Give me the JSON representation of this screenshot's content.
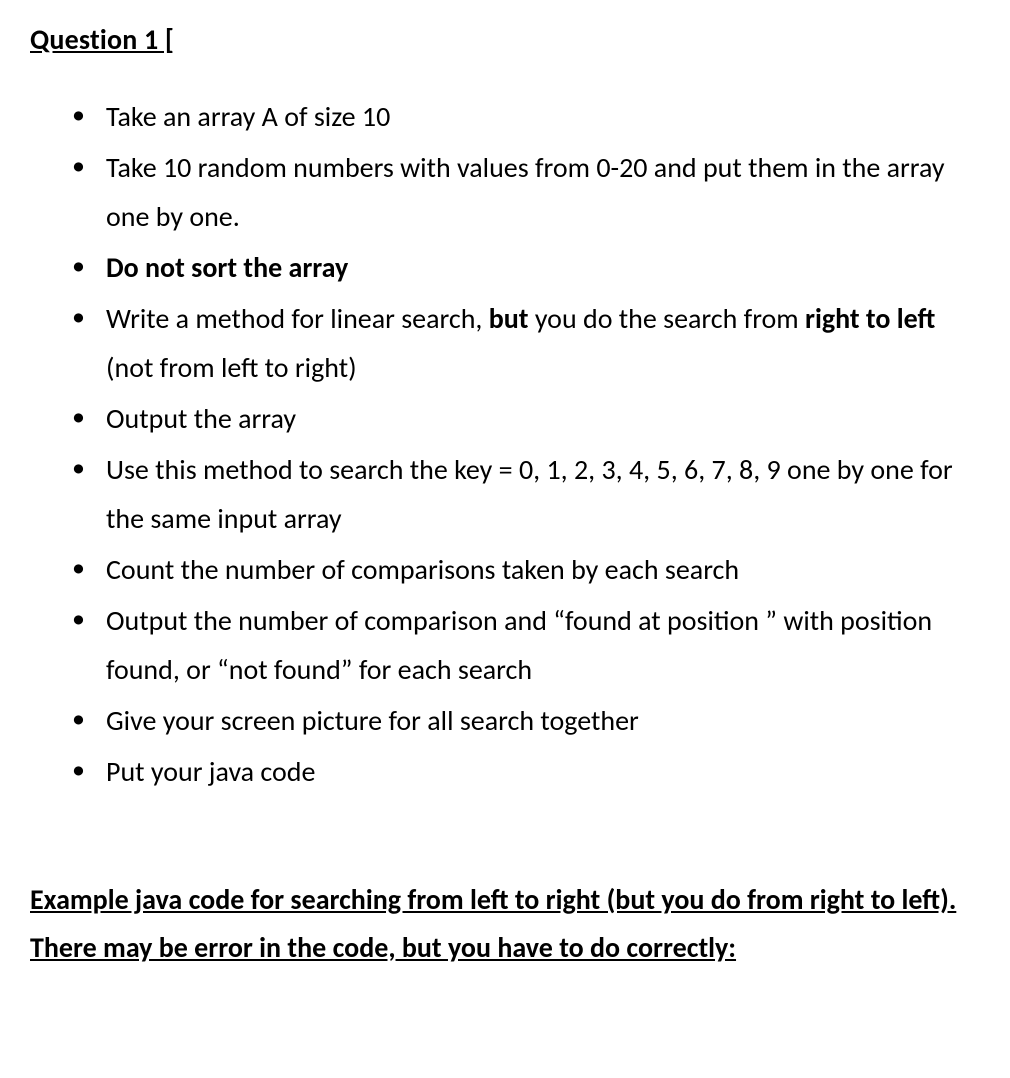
{
  "title": "Question 1 [",
  "bullets": {
    "b1": "Take an array A of size 10",
    "b2": "Take 10 random numbers with values from 0-20 and put them in the array one by one.",
    "b3": "Do not sort the array",
    "b4_pre": "Write a method for linear search, ",
    "b4_bold1": "but",
    "b4_mid1": " you do the search from ",
    "b4_bold2": "right to left",
    "b4_mid2": " (not from left to right)",
    "b5": "Output the array",
    "b6": "Use this method to search the key = 0, 1, 2, 3, 4, 5, 6, 7, 8, 9 one by one for the same input array",
    "b7": "Count the number of comparisons taken by each search",
    "b8": "Output the number of comparison and “found at position ” with position found, or “not found” for each  search",
    "b9": "Give your screen picture for all search together",
    "b10": "Put your java code"
  },
  "footer": "Example java code for searching from left to right (but you do from right to left). There may be error in the code, but you have to do correctly:"
}
